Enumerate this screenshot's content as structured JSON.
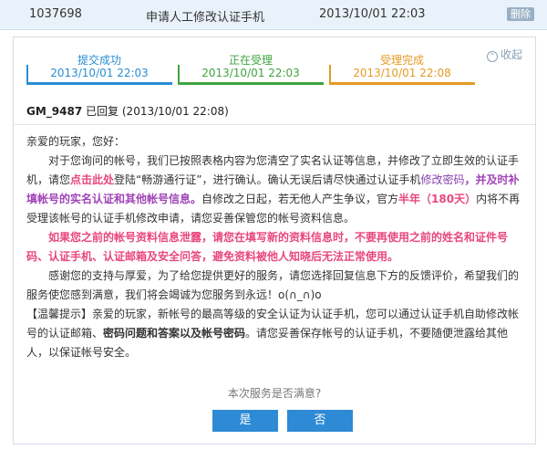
{
  "header": {
    "ticket_id": "1037698",
    "title": "申请人工修改认证手机",
    "time": "2013/10/01 22:03",
    "delete_label": "删除"
  },
  "progress": {
    "steps": [
      {
        "label": "提交成功",
        "time": "2013/10/01 22:03"
      },
      {
        "label": "正在受理",
        "time": "2013/10/01 22:03"
      },
      {
        "label": "受理完成",
        "time": "2013/10/01 22:08"
      }
    ],
    "collapse_label": "收起"
  },
  "reply": {
    "author": "GM_9487",
    "status": "已回复",
    "time": "(2013/10/01 22:08)"
  },
  "message": {
    "greeting": "亲爱的玩家，您好：",
    "p1_a": "对于您询问的帐号，我们已按照表格内容为您清空了实名认证等信息，并修改了立即生效的认证手机，请您",
    "p1_link": "点击此处",
    "p1_b": "登陆“畅游通行证”，进行确认。确认无误后请尽快通过认证手机",
    "p1_pw": "修改密码",
    "p1_c": "，并及时补填帐号的实名认证和其他帐号信息。",
    "p1_d": "自修改之日起，若无他人产生争议，官方",
    "p1_half": "半年（180天）",
    "p1_e": "内将不再受理该帐号的认证手机修改申请，请您妥善保管您的帐号资料信息。",
    "p2": "如果您之前的帐号资料信息泄露，请您在填写新的资料信息时，不要再使用之前的姓名和证件号码、认证手机、认证邮箱及安全问答，避免资料被他人知晓后无法正常使用。",
    "p3": "感谢您的支持与厚爱，为了给您提供更好的服务，请您选择回复信息下方的反馈评价，希望我们的服务使您感到满意，我们将会竭诚为您服务到永远！o(∩_∩)o",
    "tip_a": "【温馨提示】亲爱的玩家，新帐号的最高等级的安全认证为认证手机，您可以通过认证手机自助修改帐号的认证邮箱、",
    "tip_b": "密码问题和答案以及帐号密码",
    "tip_c": "。请您妥善保存帐号的认证手机，不要随便泄露给其他人，以保证帐号安全。"
  },
  "feedback": {
    "question": "本次服务是否满意?",
    "yes_label": "是",
    "no_label": "否"
  }
}
